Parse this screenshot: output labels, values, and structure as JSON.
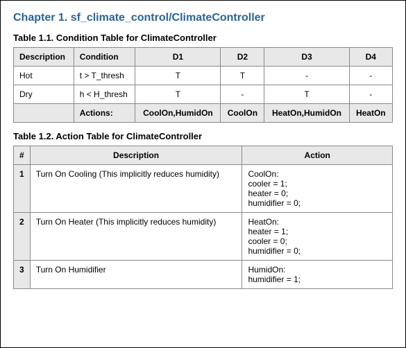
{
  "chapter_title": "Chapter 1. sf_climate_control/ClimateController",
  "table1": {
    "title": "Table 1.1. Condition Table for ClimateController",
    "headers": {
      "description": "Description",
      "condition": "Condition",
      "d1": "D1",
      "d2": "D2",
      "d3": "D3",
      "d4": "D4"
    },
    "rows": [
      {
        "description": "Hot",
        "condition": "t > T_thresh",
        "d1": "T",
        "d2": "T",
        "d3": "-",
        "d4": "-"
      },
      {
        "description": "Dry",
        "condition": "h < H_thresh",
        "d1": "T",
        "d2": "-",
        "d3": "T",
        "d4": "-"
      }
    ],
    "actions_label": "Actions:",
    "actions": {
      "d1": "CoolOn,HumidOn",
      "d2": "CoolOn",
      "d3": "HeatOn,HumidOn",
      "d4": "HeatOn"
    }
  },
  "table2": {
    "title": "Table 1.2. Action Table for ClimateController",
    "headers": {
      "num": "#",
      "description": "Description",
      "action": "Action"
    },
    "rows": [
      {
        "num": "1",
        "description": "Turn On Cooling (This implicitly reduces humidity)",
        "action": "CoolOn:\ncooler = 1;\nheater = 0;\nhumidifier = 0;"
      },
      {
        "num": "2",
        "description": "Turn On Heater (This implicitly reduces humidity)",
        "action": "HeatOn:\nheater = 1;\ncooler = 0;\nhumidifier = 0;"
      },
      {
        "num": "3",
        "description": "Turn On Humidifier",
        "action": "HumidOn:\nhumidifier = 1;"
      }
    ]
  }
}
